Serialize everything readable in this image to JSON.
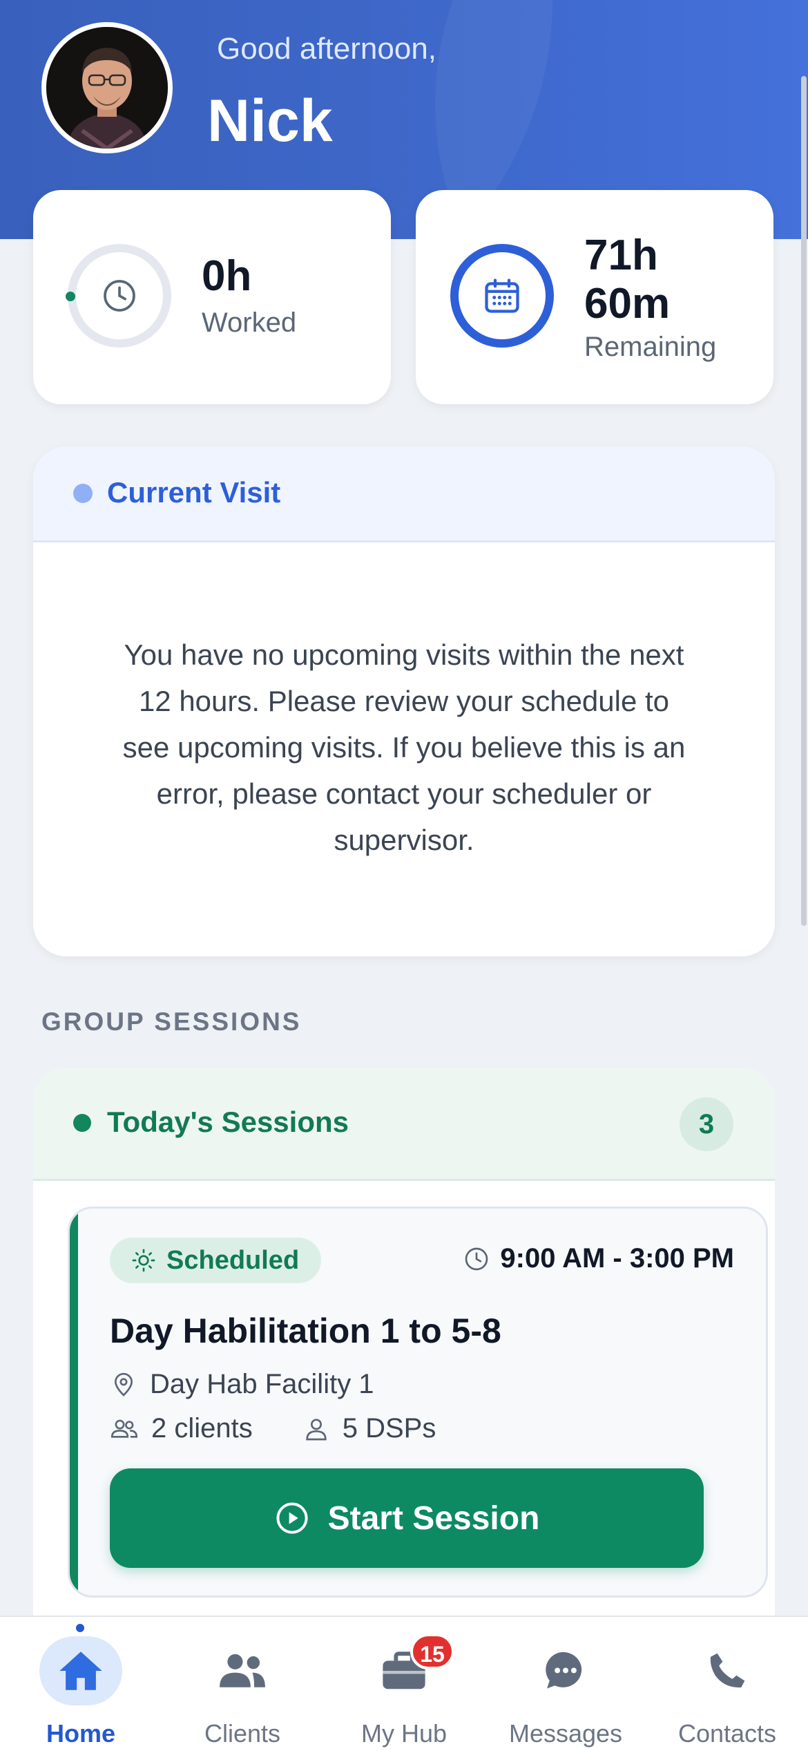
{
  "header": {
    "greeting": "Good afternoon,",
    "name": "Nick"
  },
  "stats": {
    "worked": {
      "value": "0h",
      "label": "Worked",
      "progress": 0
    },
    "remaining": {
      "value_line1": "71h",
      "value_line2": "60m",
      "label": "Remaining"
    }
  },
  "current_visit": {
    "title": "Current Visit",
    "message": "You have no upcoming visits within the next 12 hours. Please review your schedule to see upcoming visits. If you believe this is an error, please contact your scheduler or supervisor."
  },
  "group_sessions": {
    "section_label": "GROUP SESSIONS",
    "title": "Today's Sessions",
    "count": "3",
    "sessions": [
      {
        "status": "Scheduled",
        "time": "9:00 AM - 3:00 PM",
        "name": "Day Habilitation 1 to 5-8",
        "location": "Day Hab Facility 1",
        "clients": "2 clients",
        "dsps": "5 DSPs",
        "action": "Start Session"
      }
    ]
  },
  "tabbar": {
    "items": [
      {
        "label": "Home",
        "icon": "home-icon",
        "active": true
      },
      {
        "label": "Clients",
        "icon": "users-icon"
      },
      {
        "label": "My Hub",
        "icon": "briefcase-icon",
        "badge": "15"
      },
      {
        "label": "Messages",
        "icon": "chat-icon"
      },
      {
        "label": "Contacts",
        "icon": "phone-icon"
      }
    ]
  },
  "colors": {
    "primary": "#2f58b8",
    "accent_green": "#0d8a61",
    "badge_red": "#e0312f"
  }
}
